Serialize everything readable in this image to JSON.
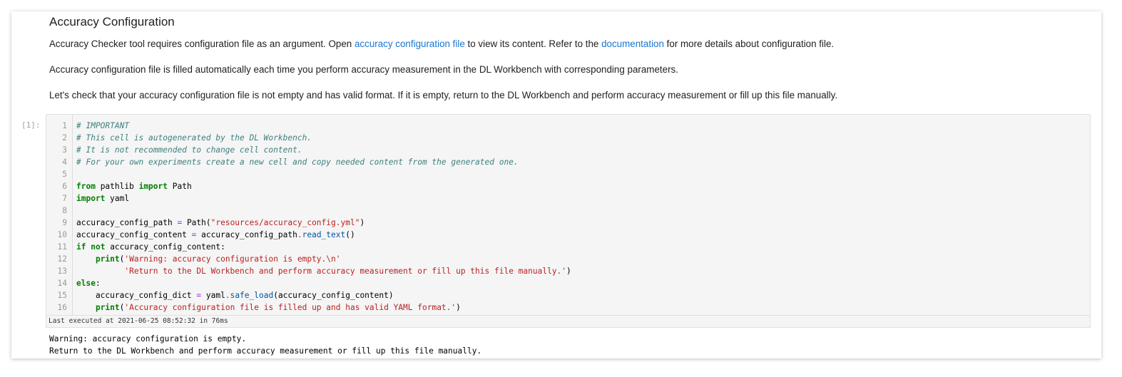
{
  "markdown": {
    "heading": "Accuracy Configuration",
    "para1": {
      "pre": "Accuracy Checker tool requires configuration file as an argument. Open ",
      "link1": "accuracy configuration file",
      "mid": " to view its content. Refer to the ",
      "link2": "documentation",
      "post": " for more details about configuration file."
    },
    "para2": "Accuracy configuration file is filled automatically each time you perform accuracy measurement in the DL Workbench with corresponding parameters.",
    "para3": "Let's check that your accuracy configuration file is not empty and has valid format. If it is empty, return to the DL Workbench and perform accuracy measurement or fill up this file manually."
  },
  "code_cell": {
    "prompt": "[1]:",
    "lines": [
      {
        "n": "1",
        "tokens": [
          [
            "cm",
            "# IMPORTANT"
          ]
        ]
      },
      {
        "n": "2",
        "tokens": [
          [
            "cm",
            "# This cell is autogenerated by the DL Workbench."
          ]
        ]
      },
      {
        "n": "3",
        "tokens": [
          [
            "cm",
            "# It is not recommended to change cell content."
          ]
        ]
      },
      {
        "n": "4",
        "tokens": [
          [
            "cm",
            "# For your own experiments create a new cell and copy needed content from the generated one."
          ]
        ]
      },
      {
        "n": "5",
        "tokens": []
      },
      {
        "n": "6",
        "tokens": [
          [
            "kw",
            "from"
          ],
          [
            "",
            " pathlib "
          ],
          [
            "kw",
            "import"
          ],
          [
            "",
            " Path"
          ]
        ]
      },
      {
        "n": "7",
        "tokens": [
          [
            "kw",
            "import"
          ],
          [
            "",
            " yaml"
          ]
        ]
      },
      {
        "n": "8",
        "tokens": []
      },
      {
        "n": "9",
        "tokens": [
          [
            "",
            "accuracy_config_path "
          ],
          [
            "op",
            "="
          ],
          [
            "",
            " Path("
          ],
          [
            "st",
            "\"resources/accuracy_config.yml\""
          ],
          [
            "",
            ")"
          ]
        ]
      },
      {
        "n": "10",
        "tokens": [
          [
            "",
            "accuracy_config_content "
          ],
          [
            "op",
            "="
          ],
          [
            "",
            " accuracy_config_path"
          ],
          [
            "op",
            "."
          ],
          [
            "fn",
            "read_text"
          ],
          [
            "",
            "()"
          ]
        ]
      },
      {
        "n": "11",
        "tokens": [
          [
            "kw",
            "if"
          ],
          [
            "",
            " "
          ],
          [
            "kw",
            "not"
          ],
          [
            "",
            " accuracy_config_content:"
          ]
        ]
      },
      {
        "n": "12",
        "tokens": [
          [
            "",
            "    "
          ],
          [
            "kw",
            "print"
          ],
          [
            "",
            "("
          ],
          [
            "st",
            "'Warning: accuracy configuration is empty.\\n'"
          ]
        ]
      },
      {
        "n": "13",
        "tokens": [
          [
            "",
            "          "
          ],
          [
            "st",
            "'Return to the DL Workbench and perform accuracy measurement or fill up this file manually.'"
          ],
          [
            "",
            ")"
          ]
        ]
      },
      {
        "n": "14",
        "tokens": [
          [
            "kw",
            "else"
          ],
          [
            "",
            ":"
          ]
        ]
      },
      {
        "n": "15",
        "tokens": [
          [
            "",
            "    accuracy_config_dict "
          ],
          [
            "op",
            "="
          ],
          [
            "",
            " yaml"
          ],
          [
            "op",
            "."
          ],
          [
            "fn",
            "safe_load"
          ],
          [
            "",
            "(accuracy_config_content)"
          ]
        ]
      },
      {
        "n": "16",
        "tokens": [
          [
            "",
            "    "
          ],
          [
            "kw",
            "print"
          ],
          [
            "",
            "("
          ],
          [
            "st",
            "'Accuracy configuration file is filled up and has valid YAML format.'"
          ],
          [
            "",
            ")"
          ]
        ]
      }
    ],
    "exec_status": "Last executed at 2021-06-25 08:52:32 in 76ms"
  },
  "output": {
    "lines": [
      "Warning: accuracy configuration is empty.",
      "Return to the DL Workbench and perform accuracy measurement or fill up this file manually."
    ]
  }
}
